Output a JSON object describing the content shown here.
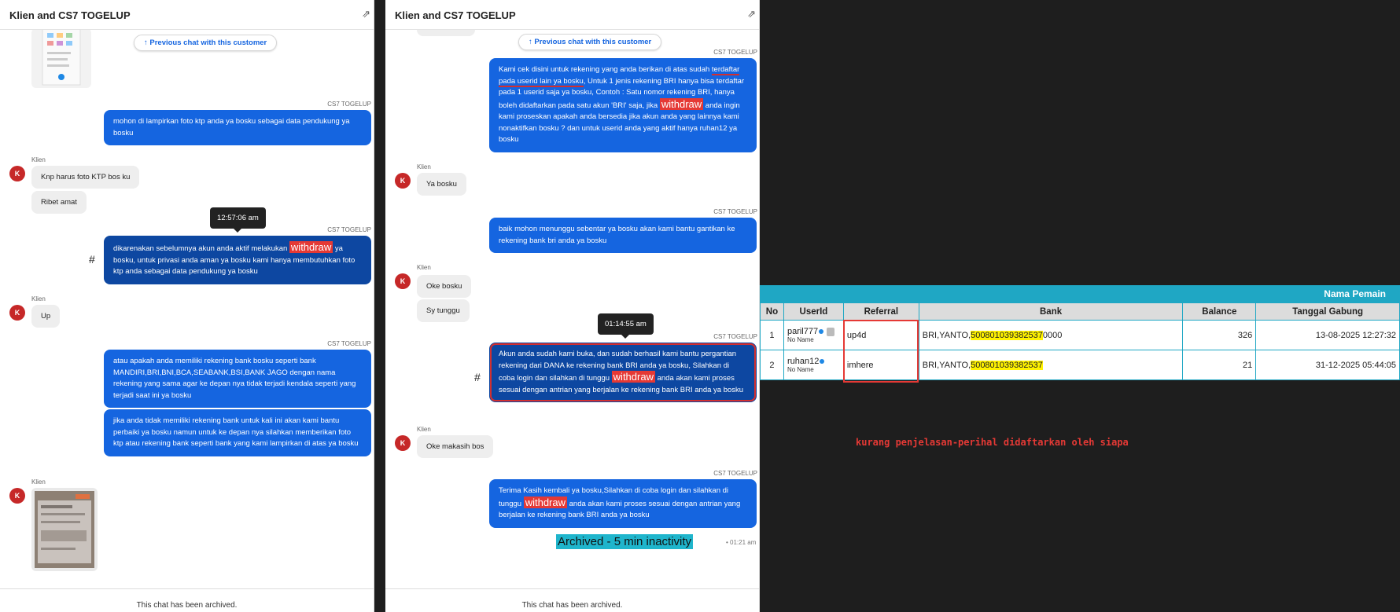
{
  "panelA": {
    "title": "Klien and CS7 TOGELUP",
    "prev_chat": "↑ Previous chat with this customer",
    "sender_cs": "CS7 TOGELUP",
    "sender_klien": "Klien",
    "avatar": "K",
    "msg1": "mohon di lampirkan foto ktp anda ya bosku sebagai data pendukung ya bosku",
    "in1": "Knp harus foto KTP bos ku",
    "in2": "Ribet amat",
    "tooltip": "12:57:06 am",
    "msg2_a": "dikarenakan sebelumnya akun anda aktif melakukan",
    "withdraw": "withdraw",
    "msg2_b": "ya bosku, untuk privasi anda aman ya bosku kami hanya membutuhkan foto ktp anda sebagai data pendukung ya bosku",
    "hash": "#",
    "in3": "Up",
    "msg3": "atau apakah anda memiliki rekening bank bosku seperti bank MANDIRI,BRI,BNI,BCA,SEABANK,BSI,BANK JAGO dengan nama rekening yang sama agar ke depan nya tidak terjadi kendala seperti yang terjadi saat ini ya bosku",
    "msg4": "jika anda tidak memiliki rekening bank untuk kali ini akan kami bantu perbaiki ya bosku namun untuk ke depan nya silahkan memberikan foto ktp atau rekening bank seperti bank yang kami lampirkan di atas ya bosku",
    "footer": "This chat has been archived.",
    "link_icon": "link-icon"
  },
  "panelB": {
    "title": "Klien and CS7 TOGELUP",
    "sender_cs": "CS7 TOGELUP",
    "sender_klien": "Klien",
    "avatar": "K",
    "msg1_a": "Kami cek disini untuk rekening yang anda berikan di atas sudah",
    "msg1_u": "terdaftar pada userid lain ya bosku",
    "msg1_b": ", Untuk 1 jenis rekening BRI hanya bisa terdaftar pada 1 userid saja ya bosku, Contoh : Satu nomor rekening BRI, hanya boleh didaftarkan pada satu akun 'BRI' saja, jika",
    "withdraw": "withdraw",
    "msg1_c": "anda ingin kami proseskan apakah anda bersedia jika akun anda yang lainnya kami nonaktifkan bosku ? dan untuk userid anda yang aktif hanya ruhan12 ya bosku",
    "in1": "Ya bosku",
    "msg2": "baik mohon menunggu sebentar ya bosku akan kami bantu gantikan ke rekening bank bri anda ya bosku",
    "in2": "Oke bosku",
    "in3": "Sy tunggu",
    "tooltip": "01:14:55 am",
    "msg3_a": "Akun anda sudah kami buka, dan sudah berhasil kami bantu pergantian rekening dari DANA ke rekening bank BRI anda ya bosku, Silahkan di coba login dan silahkan di tunggu",
    "msg3_b": "anda akan kami proses sesuai dengan antrian yang berjalan ke rekening bank BRI anda ya bosku",
    "hash": "#",
    "in4": "Oke makasih bos",
    "msg4_a": "Terima Kasih kembali ya bosku,Silahkan di coba login dan silahkan di tunggu",
    "msg4_b": "anda akan kami proses sesuai dengan antrian yang berjalan ke rekening bank BRI anda ya bosku",
    "archived": "Archived - 5 min inactivity",
    "archived_time": "• 01:21 am",
    "footer": "This chat has been archived."
  },
  "table": {
    "band_title": "Nama Pemain",
    "headers": [
      "No",
      "UserId",
      "Referral",
      "Bank",
      "Balance",
      "Tanggal Gabung"
    ],
    "rows": [
      {
        "no": "1",
        "userid": "paril777",
        "sub": "No Name",
        "referral": "up4d",
        "bank_prefix": "BRI,YANTO,",
        "bank_hl": "500801039382537",
        "bank_suffix": "0000",
        "balance": "326",
        "date": "13-08-2025 12:27:32"
      },
      {
        "no": "2",
        "userid": "ruhan12",
        "sub": "No Name",
        "referral": "imhere",
        "bank_prefix": "BRI,YANTO,",
        "bank_hl": "500801039382537",
        "bank_suffix": "",
        "balance": "21",
        "date": "31-12-2025 05:44:05"
      }
    ]
  },
  "note": "kurang penjelasan-perihal didaftarkan oleh siapa",
  "colors": {
    "bubble": "#1565e0",
    "bubble_dark": "#0d47a1",
    "alert": "#e53935",
    "table_accent": "#1fa7c4",
    "highlight": "#fff200"
  }
}
